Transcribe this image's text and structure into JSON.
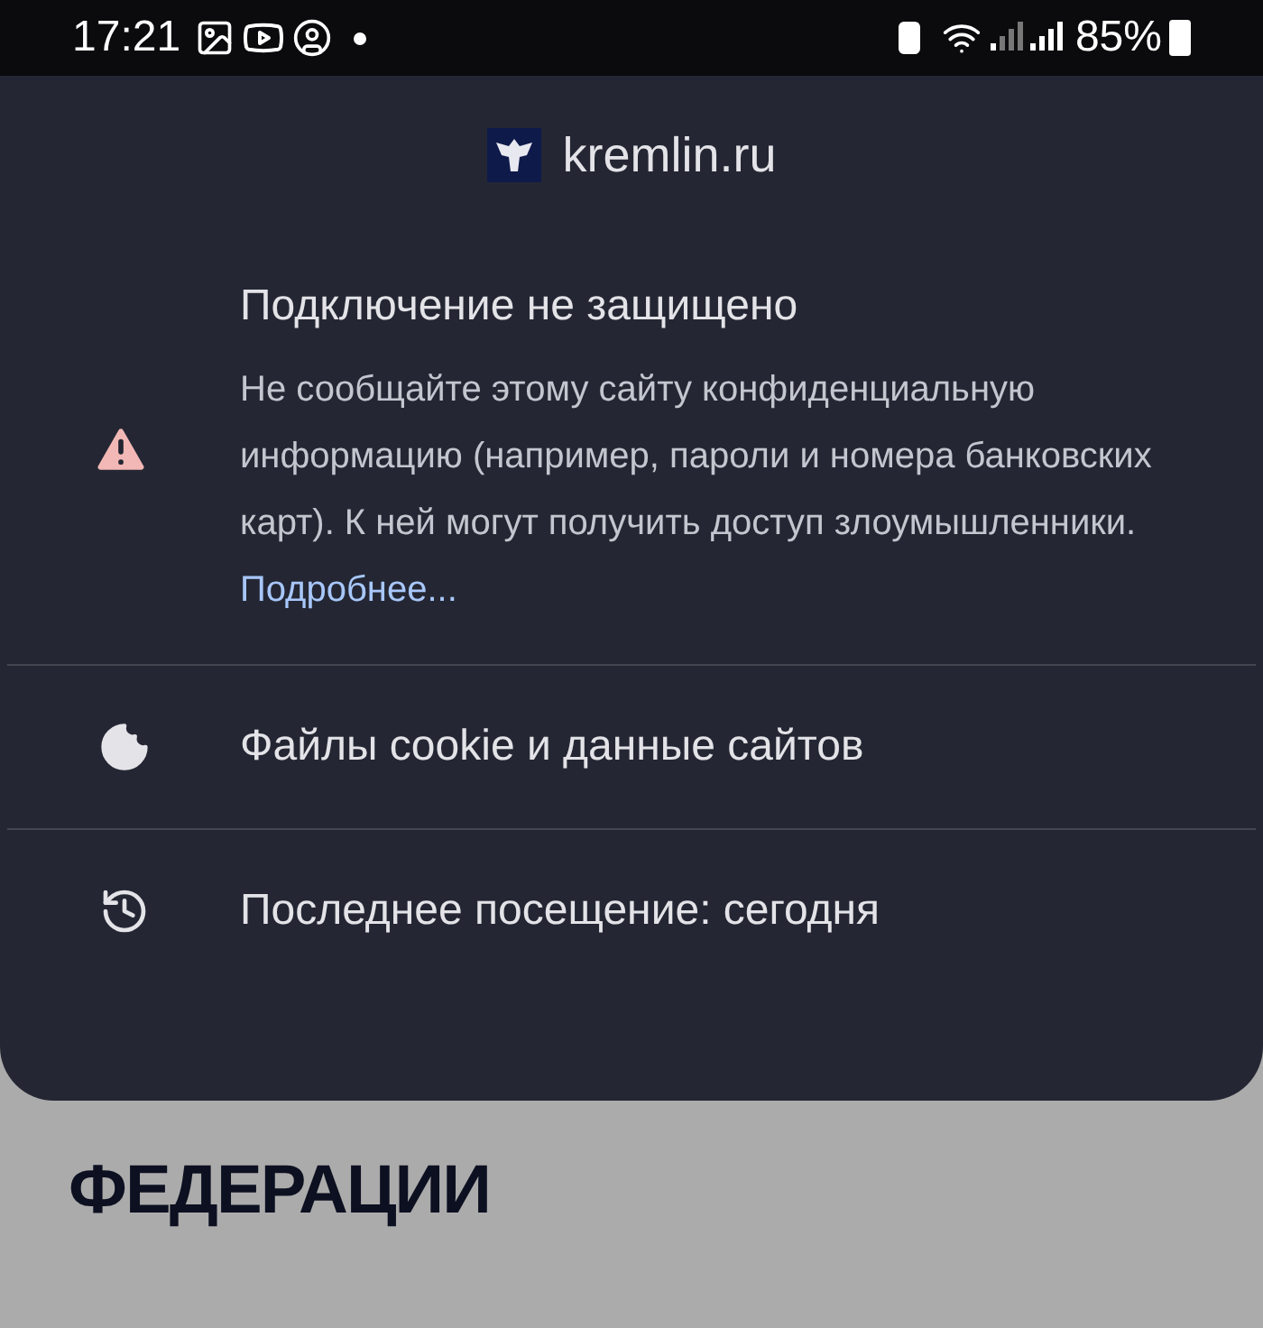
{
  "status_bar": {
    "time": "17:21",
    "battery": "85%"
  },
  "site": {
    "domain": "kremlin.ru"
  },
  "security": {
    "title": "Подключение не защищено",
    "text": "Не сообщайте этому сайту конфиденциальную информацию (например, пароли и номера банковских карт). К ней могут получить доступ злоумышленники.",
    "link": "Подробнее..."
  },
  "items": [
    {
      "kind": "cookies",
      "label": "Файлы cookie и данные сайтов"
    },
    {
      "kind": "history",
      "label": "Последнее посещение: сегодня"
    }
  ],
  "page": {
    "heading": "ФЕДЕРАЦИИ"
  }
}
